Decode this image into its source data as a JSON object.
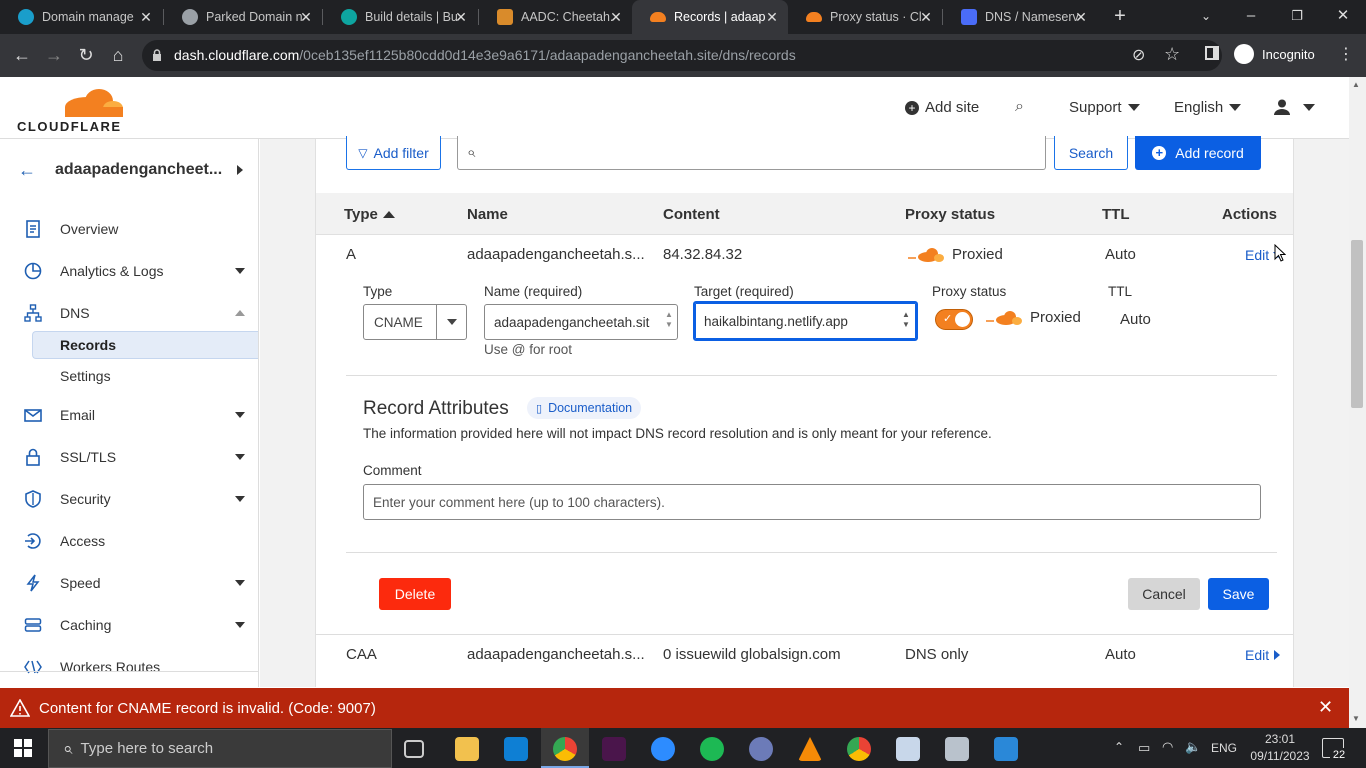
{
  "browser": {
    "tabs": [
      {
        "title": "Domain manage",
        "color": "#1a9ecb"
      },
      {
        "title": "Parked Domain n",
        "color": "#9aa0a6"
      },
      {
        "title": "Build details | Bu",
        "color": "#0ea5a0"
      },
      {
        "title": "AADC: Cheetah.",
        "color": "#d98b2b"
      },
      {
        "title": "Records | adaap",
        "color": "#f38020"
      },
      {
        "title": "Proxy status · Cl",
        "color": "#f38020"
      },
      {
        "title": "DNS / Nameserv",
        "color": "#4a6cf7"
      }
    ],
    "active_tab": 4,
    "url_host": "dash.cloudflare.com",
    "url_path": "/0ceb135ef1125b80cdd0d14e3e9a6171/adaapadengancheetah.site/dns/records",
    "incognito_label": "Incognito"
  },
  "header": {
    "logo_text": "CLOUDFLARE",
    "add_site": "Add site",
    "support": "Support",
    "language": "English"
  },
  "sidebar": {
    "domain": "adaapadengancheet...",
    "items": [
      {
        "label": "Overview",
        "icon": "document-icon",
        "caret": false
      },
      {
        "label": "Analytics & Logs",
        "icon": "analytics-icon",
        "caret": true
      },
      {
        "label": "DNS",
        "icon": "network-icon",
        "caret": true
      },
      {
        "label": "Records",
        "icon": "",
        "caret": false
      },
      {
        "label": "Settings",
        "icon": "",
        "caret": false
      },
      {
        "label": "Email",
        "icon": "email-icon",
        "caret": true
      },
      {
        "label": "SSL/TLS",
        "icon": "lock-icon",
        "caret": true
      },
      {
        "label": "Security",
        "icon": "shield-icon",
        "caret": true
      },
      {
        "label": "Access",
        "icon": "access-icon",
        "caret": false
      },
      {
        "label": "Speed",
        "icon": "bolt-icon",
        "caret": true
      },
      {
        "label": "Caching",
        "icon": "storage-icon",
        "caret": true
      },
      {
        "label": "Workers Routes",
        "icon": "workers-icon",
        "caret": false
      }
    ]
  },
  "toolbar": {
    "add_filter": "Add filter",
    "search_button": "Search",
    "add_record": "Add record"
  },
  "table": {
    "headers": {
      "type": "Type",
      "name": "Name",
      "content": "Content",
      "proxy": "Proxy status",
      "ttl": "TTL",
      "actions": "Actions"
    },
    "rows": [
      {
        "type": "A",
        "name": "adaapadengancheetah.s...",
        "content": "84.32.84.32",
        "proxy": "Proxied",
        "ttl": "Auto",
        "action": "Edit"
      },
      {
        "type": "CAA",
        "name": "adaapadengancheetah.s...",
        "content": "0 issuewild globalsign.com",
        "proxy": "DNS only",
        "ttl": "Auto",
        "action": "Edit"
      }
    ]
  },
  "edit_form": {
    "type_label": "Type",
    "type_value": "CNAME",
    "name_label": "Name (required)",
    "name_value": "adaapadengancheetah.sit",
    "name_hint": "Use @ for root",
    "target_label": "Target (required)",
    "target_value": "haikalbintang.netlify.app",
    "proxy_label": "Proxy status",
    "proxy_value": "Proxied",
    "proxy_on": true,
    "ttl_label": "TTL",
    "ttl_value": "Auto",
    "attributes_title": "Record Attributes",
    "documentation": "Documentation",
    "attributes_desc": "The information provided here will not impact DNS record resolution and is only meant for your reference.",
    "comment_label": "Comment",
    "comment_placeholder": "Enter your comment here (up to 100 characters).",
    "delete": "Delete",
    "cancel": "Cancel",
    "save": "Save"
  },
  "error_banner": {
    "message": "Content for CNAME record is invalid. (Code: 9007)"
  },
  "taskbar": {
    "search_placeholder": "Type here to search",
    "language": "ENG",
    "time": "23:01",
    "date": "09/11/2023",
    "notifications": "22"
  },
  "colors": {
    "cloudflare_orange": "#f38020",
    "accent_blue": "#0b5fe3",
    "error_red": "#b6260d",
    "delete_red": "#fc2a0d"
  }
}
